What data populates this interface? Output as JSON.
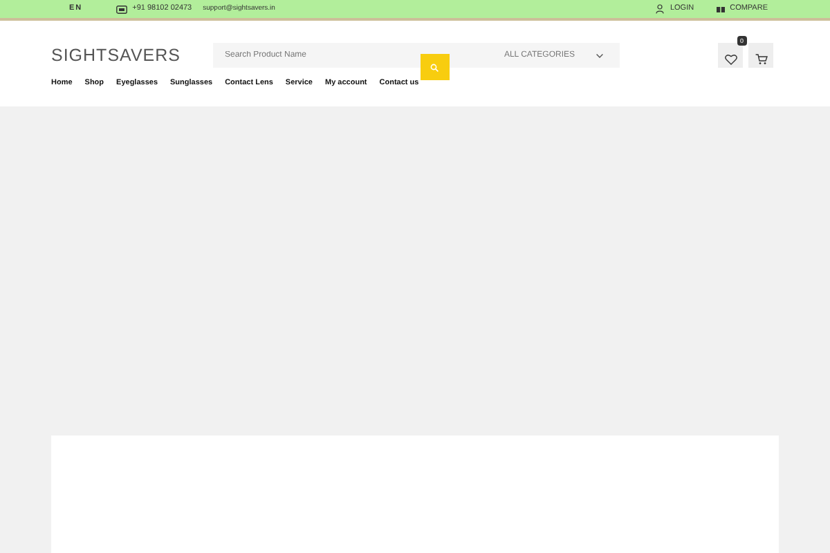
{
  "topbar": {
    "language": "EN",
    "phone": "+91 98102 02473",
    "email": "support@sightsavers.in",
    "links": [
      {
        "kind": "login",
        "label": "LOGIN"
      },
      {
        "kind": "compare",
        "label": "COMPARE"
      }
    ]
  },
  "header": {
    "logo": "SIGHTSAVERS",
    "search": {
      "placeholder": "Search Product Name",
      "category": "ALL CATEGORIES"
    },
    "wishlist_count": "0"
  },
  "nav": [
    "Home",
    "Shop",
    "Eyeglasses",
    "Sunglasses",
    "Contact Lens",
    "Service",
    "My account",
    "Contact us"
  ]
}
